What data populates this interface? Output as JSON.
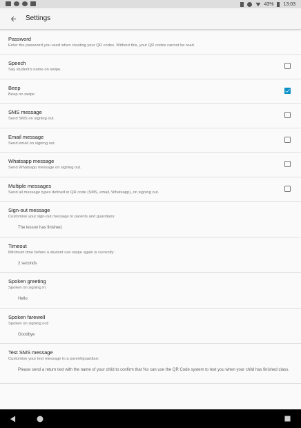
{
  "status_bar": {
    "battery": "43%",
    "time": "13:03"
  },
  "app_bar": {
    "title": "Settings",
    "back_icon": "arrow-back-icon"
  },
  "settings": [
    {
      "id": "password",
      "title": "Password",
      "summary": "Enter the password you used when creating your QR codes. Without this, your QR codes cannot be read."
    },
    {
      "id": "speech",
      "title": "Speech",
      "summary": "Say student's name on swipe.",
      "checked": false
    },
    {
      "id": "beep",
      "title": "Beep",
      "summary": "Beep on swipe",
      "checked": true
    },
    {
      "id": "sms",
      "title": "SMS message",
      "summary": "Send SMS on signing out.",
      "checked": false
    },
    {
      "id": "email",
      "title": "Email message",
      "summary": "Send email on signing out.",
      "checked": false
    },
    {
      "id": "whatsapp",
      "title": "Whatsapp message",
      "summary": "Send Whatsapp message on signing out.",
      "checked": false
    },
    {
      "id": "multiple",
      "title": "Multiple messages",
      "summary": "Send all message types defined in QR code (SMS, email, Whatsapp), on signing out.",
      "checked": false
    },
    {
      "id": "signout",
      "title": "Sign-out message",
      "summary": "Customise your sign-out message to parents and guardians:",
      "value": "The lesson has finished."
    },
    {
      "id": "timeout",
      "title": "Timeout",
      "summary": "Minimum time before a student can swipe again is currently:",
      "value": "2 seconds"
    },
    {
      "id": "greeting",
      "title": "Spoken greeting",
      "summary": "Spoken on signing in:",
      "value": "Hello"
    },
    {
      "id": "farewell",
      "title": "Spoken farewell",
      "summary": "Spoken on signing out:",
      "value": "Goodbye"
    },
    {
      "id": "testsms",
      "title": "Test SMS message",
      "summary": "Customise your test message to a parent/guardian:",
      "value": "Please send a return text with the name of your child to confirm that %s can use the QR Code system to text you when your child has finished class."
    }
  ],
  "colors": {
    "accent": "#0a8fc7",
    "background": "#fafafa",
    "nav_bar": "#000000"
  },
  "nav_bar": {
    "back_icon": "nav-back-icon",
    "home_icon": "nav-home-icon",
    "recents_icon": "nav-recents-icon"
  }
}
